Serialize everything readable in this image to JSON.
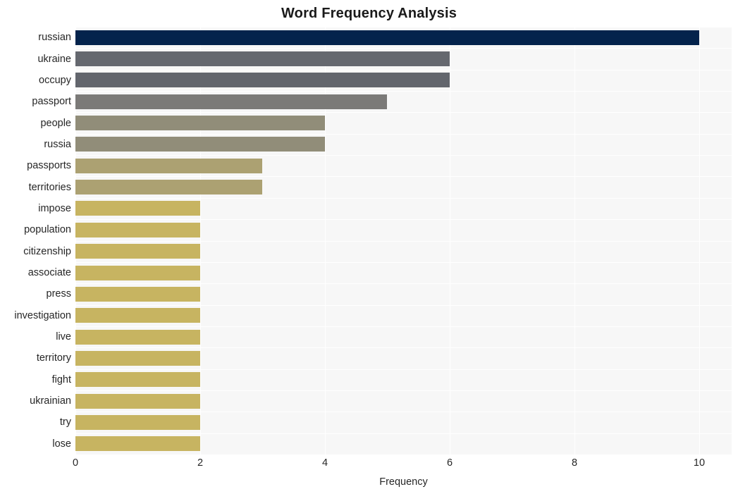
{
  "chart": {
    "title": "Word Frequency Analysis",
    "xaxis_title": "Frequency",
    "yaxis_title": "",
    "xticks": [
      "0",
      "2",
      "4",
      "6",
      "8",
      "10"
    ],
    "background_color": "#ffffff",
    "plot_background_color": "#f7f7f7",
    "gridline_color": "#ffffff"
  },
  "chart_data": {
    "type": "bar",
    "orientation": "horizontal",
    "title": "Word Frequency Analysis",
    "xlabel": "Frequency",
    "ylabel": "",
    "xlim": [
      0,
      10.52
    ],
    "xticks": [
      0,
      2,
      4,
      6,
      8,
      10
    ],
    "grid": true,
    "legend": null,
    "categories": [
      "russian",
      "ukraine",
      "occupy",
      "passport",
      "people",
      "russia",
      "passports",
      "territories",
      "impose",
      "population",
      "citizenship",
      "associate",
      "press",
      "investigation",
      "live",
      "territory",
      "fight",
      "ukrainian",
      "try",
      "lose"
    ],
    "values": [
      10,
      6,
      6,
      5,
      4,
      4,
      3,
      3,
      2,
      2,
      2,
      2,
      2,
      2,
      2,
      2,
      2,
      2,
      2,
      2
    ],
    "colors": [
      "#04234c",
      "#65686f",
      "#63666d",
      "#7b7a78",
      "#918d79",
      "#918d79",
      "#aca172",
      "#aca172",
      "#c7b461",
      "#c7b461",
      "#c7b461",
      "#c7b461",
      "#c7b461",
      "#c7b461",
      "#c7b461",
      "#c7b461",
      "#c7b461",
      "#c7b461",
      "#c7b461",
      "#c7b461"
    ]
  }
}
